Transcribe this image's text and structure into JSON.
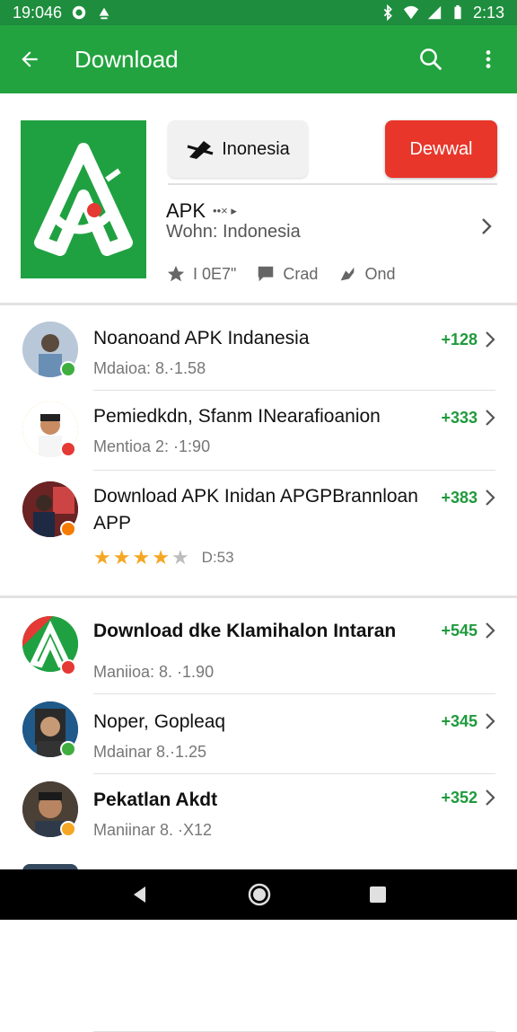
{
  "status_bar": {
    "time": "19:046",
    "clock_right": "2:13"
  },
  "app_bar": {
    "title": "Download"
  },
  "hero": {
    "chip_label": "Inonesia",
    "download_label": "Dewwal",
    "apk_title": "APK",
    "apk_small": "••× ▸",
    "subtitle": "Wohn: Indonesia",
    "meta": {
      "rating": "I 0E7\"",
      "reviews": "Crad",
      "share": "Ond"
    }
  },
  "list_one": [
    {
      "name": "Noanoand APK Indanesia",
      "detail": "Mdaioa: 8.·1.58",
      "count": "+128"
    },
    {
      "name": "Pemiedkdn, Sfanm INearafioanion",
      "detail": "Mentioa 2: ·1:90",
      "count": "+333"
    },
    {
      "name": "Download APK Inidan APGPBrannloan APP",
      "rating_text": "D:53",
      "count": "+383"
    }
  ],
  "list_two": [
    {
      "name": "Download dke Klamihalon Intaran",
      "detail": "Maniioa: 8. ·1.90",
      "count": "+545"
    },
    {
      "name": "Noper, Gopleaq",
      "detail": "Mdainar 8.·1.25",
      "count": "+345"
    },
    {
      "name": "Pekatlan Akdt",
      "detail": "Maniinar 8. ·X12",
      "count": "+352"
    }
  ],
  "colors": {
    "appbar": "#22a33f",
    "status": "#1e8e3e",
    "download_button": "#e8362a",
    "count_green": "#1f9a3d",
    "star": "#f5a623"
  },
  "icons": [
    "back-arrow-icon",
    "search-icon",
    "more-vert-icon",
    "star-icon",
    "comment-icon",
    "share-icon",
    "chevron-right-icon",
    "nav-back-icon",
    "nav-home-icon",
    "nav-recents-icon"
  ]
}
